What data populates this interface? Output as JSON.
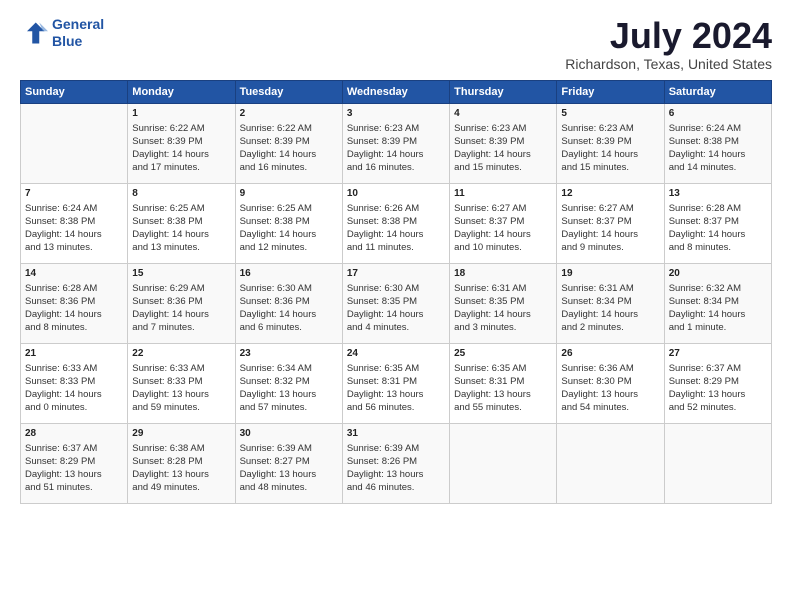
{
  "header": {
    "logo_line1": "General",
    "logo_line2": "Blue",
    "title": "July 2024",
    "subtitle": "Richardson, Texas, United States"
  },
  "days_header": [
    "Sunday",
    "Monday",
    "Tuesday",
    "Wednesday",
    "Thursday",
    "Friday",
    "Saturday"
  ],
  "weeks": [
    [
      {
        "day": "",
        "info": ""
      },
      {
        "day": "1",
        "info": "Sunrise: 6:22 AM\nSunset: 8:39 PM\nDaylight: 14 hours\nand 17 minutes."
      },
      {
        "day": "2",
        "info": "Sunrise: 6:22 AM\nSunset: 8:39 PM\nDaylight: 14 hours\nand 16 minutes."
      },
      {
        "day": "3",
        "info": "Sunrise: 6:23 AM\nSunset: 8:39 PM\nDaylight: 14 hours\nand 16 minutes."
      },
      {
        "day": "4",
        "info": "Sunrise: 6:23 AM\nSunset: 8:39 PM\nDaylight: 14 hours\nand 15 minutes."
      },
      {
        "day": "5",
        "info": "Sunrise: 6:23 AM\nSunset: 8:39 PM\nDaylight: 14 hours\nand 15 minutes."
      },
      {
        "day": "6",
        "info": "Sunrise: 6:24 AM\nSunset: 8:38 PM\nDaylight: 14 hours\nand 14 minutes."
      }
    ],
    [
      {
        "day": "7",
        "info": "Sunrise: 6:24 AM\nSunset: 8:38 PM\nDaylight: 14 hours\nand 13 minutes."
      },
      {
        "day": "8",
        "info": "Sunrise: 6:25 AM\nSunset: 8:38 PM\nDaylight: 14 hours\nand 13 minutes."
      },
      {
        "day": "9",
        "info": "Sunrise: 6:25 AM\nSunset: 8:38 PM\nDaylight: 14 hours\nand 12 minutes."
      },
      {
        "day": "10",
        "info": "Sunrise: 6:26 AM\nSunset: 8:38 PM\nDaylight: 14 hours\nand 11 minutes."
      },
      {
        "day": "11",
        "info": "Sunrise: 6:27 AM\nSunset: 8:37 PM\nDaylight: 14 hours\nand 10 minutes."
      },
      {
        "day": "12",
        "info": "Sunrise: 6:27 AM\nSunset: 8:37 PM\nDaylight: 14 hours\nand 9 minutes."
      },
      {
        "day": "13",
        "info": "Sunrise: 6:28 AM\nSunset: 8:37 PM\nDaylight: 14 hours\nand 8 minutes."
      }
    ],
    [
      {
        "day": "14",
        "info": "Sunrise: 6:28 AM\nSunset: 8:36 PM\nDaylight: 14 hours\nand 8 minutes."
      },
      {
        "day": "15",
        "info": "Sunrise: 6:29 AM\nSunset: 8:36 PM\nDaylight: 14 hours\nand 7 minutes."
      },
      {
        "day": "16",
        "info": "Sunrise: 6:30 AM\nSunset: 8:36 PM\nDaylight: 14 hours\nand 6 minutes."
      },
      {
        "day": "17",
        "info": "Sunrise: 6:30 AM\nSunset: 8:35 PM\nDaylight: 14 hours\nand 4 minutes."
      },
      {
        "day": "18",
        "info": "Sunrise: 6:31 AM\nSunset: 8:35 PM\nDaylight: 14 hours\nand 3 minutes."
      },
      {
        "day": "19",
        "info": "Sunrise: 6:31 AM\nSunset: 8:34 PM\nDaylight: 14 hours\nand 2 minutes."
      },
      {
        "day": "20",
        "info": "Sunrise: 6:32 AM\nSunset: 8:34 PM\nDaylight: 14 hours\nand 1 minute."
      }
    ],
    [
      {
        "day": "21",
        "info": "Sunrise: 6:33 AM\nSunset: 8:33 PM\nDaylight: 14 hours\nand 0 minutes."
      },
      {
        "day": "22",
        "info": "Sunrise: 6:33 AM\nSunset: 8:33 PM\nDaylight: 13 hours\nand 59 minutes."
      },
      {
        "day": "23",
        "info": "Sunrise: 6:34 AM\nSunset: 8:32 PM\nDaylight: 13 hours\nand 57 minutes."
      },
      {
        "day": "24",
        "info": "Sunrise: 6:35 AM\nSunset: 8:31 PM\nDaylight: 13 hours\nand 56 minutes."
      },
      {
        "day": "25",
        "info": "Sunrise: 6:35 AM\nSunset: 8:31 PM\nDaylight: 13 hours\nand 55 minutes."
      },
      {
        "day": "26",
        "info": "Sunrise: 6:36 AM\nSunset: 8:30 PM\nDaylight: 13 hours\nand 54 minutes."
      },
      {
        "day": "27",
        "info": "Sunrise: 6:37 AM\nSunset: 8:29 PM\nDaylight: 13 hours\nand 52 minutes."
      }
    ],
    [
      {
        "day": "28",
        "info": "Sunrise: 6:37 AM\nSunset: 8:29 PM\nDaylight: 13 hours\nand 51 minutes."
      },
      {
        "day": "29",
        "info": "Sunrise: 6:38 AM\nSunset: 8:28 PM\nDaylight: 13 hours\nand 49 minutes."
      },
      {
        "day": "30",
        "info": "Sunrise: 6:39 AM\nSunset: 8:27 PM\nDaylight: 13 hours\nand 48 minutes."
      },
      {
        "day": "31",
        "info": "Sunrise: 6:39 AM\nSunset: 8:26 PM\nDaylight: 13 hours\nand 46 minutes."
      },
      {
        "day": "",
        "info": ""
      },
      {
        "day": "",
        "info": ""
      },
      {
        "day": "",
        "info": ""
      }
    ]
  ]
}
